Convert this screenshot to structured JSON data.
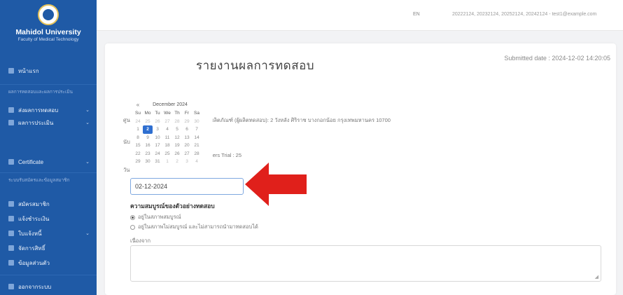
{
  "sidebar": {
    "university": "Mahidol University",
    "faculty": "Faculty of Medical Technology",
    "home": "หน้าแรก",
    "section1": "ผลการทดสอบและผลการประเมิน",
    "send_results": "ส่งผลการทดสอบ",
    "evaluation": "ผลการประเมิน",
    "certificate": "Certificate",
    "section2": "ระบบรับสมัครและข้อมูลสมาชิก",
    "register": "สมัครสมาชิก",
    "payment_notice": "แจ้งชำระเงิน",
    "invoice": "ใบแจ้งหนี้",
    "ship_items": "จัดการสิทธิ์",
    "personal_info": "ข้อมูลส่วนตัว",
    "logout": "ออกจากระบบ"
  },
  "topbar": {
    "lang": "EN",
    "user": "20222124, 20232124, 20252124, 20242124 - test1@example.com"
  },
  "card": {
    "submitted": "Submitted date : 2024-12-02 14:20:05",
    "title": "รายงานผลการทดสอบ",
    "address_label": "ชื่อ",
    "address_value": "มีผลิตภัณฑ์ (ผู้ผลิตทดสอบ): 2 วังหลัง ศิริราช บางกอกน้อย กรุงเทพมหานคร 10700",
    "markers_value": "kers   Trial : 25",
    "date_value": "02-12-2024",
    "completeness_title": "ความสมบูรณ์ของตัวอย่างทดสอบ",
    "option1": "อยู่ในสภาพสมบูรณ์",
    "option2": "อยู่ในสภาพไม่สมบูรณ์ และไม่สามารถนำมาทดสอบได้",
    "reason_label": "เนื่องจาก"
  },
  "datepicker": {
    "prev": "«",
    "title": "December 2024",
    "dow": [
      "Su",
      "Mo",
      "Tu",
      "We",
      "Th",
      "Fr",
      "Sa"
    ],
    "weeks": [
      [
        "24",
        "25",
        "26",
        "27",
        "28",
        "29",
        "30"
      ],
      [
        "1",
        "2",
        "3",
        "4",
        "5",
        "6",
        "7"
      ],
      [
        "8",
        "9",
        "10",
        "11",
        "12",
        "13",
        "14"
      ],
      [
        "15",
        "16",
        "17",
        "18",
        "19",
        "20",
        "21"
      ],
      [
        "22",
        "23",
        "24",
        "25",
        "26",
        "27",
        "28"
      ],
      [
        "29",
        "30",
        "31",
        "1",
        "2",
        "3",
        "4"
      ]
    ],
    "selected": "2"
  },
  "row_labels": {
    "r1": "ศูนย์",
    "r2": "นับ",
    "r3": "วัน"
  },
  "colors": {
    "sidebar": "#1f5aa6",
    "accent": "#2f6fd0",
    "arrow": "#e0201b"
  }
}
